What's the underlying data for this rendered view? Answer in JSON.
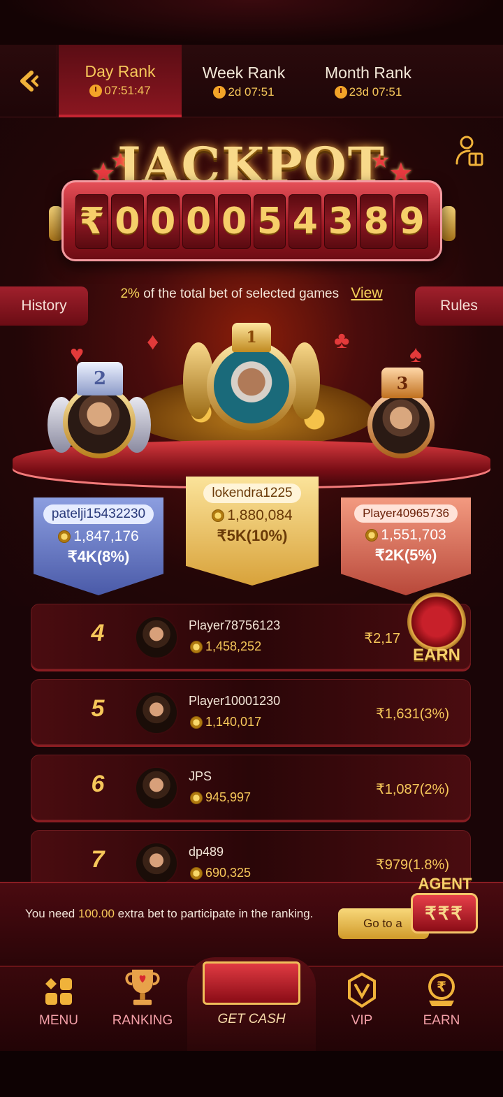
{
  "tabs": [
    {
      "label": "Day Rank",
      "time": "07:51:47"
    },
    {
      "label": "Week Rank",
      "time": "2d 07:51"
    },
    {
      "label": "Month Rank",
      "time": "23d 07:51"
    }
  ],
  "jackpot": {
    "title": "JACKPOT",
    "currency": "₹",
    "digits": [
      "0",
      "0",
      "0",
      "0",
      "5",
      "4",
      "3",
      "8",
      "9"
    ],
    "note_pct": "2%",
    "note_text": "of the total bet of selected games",
    "view_label": "View"
  },
  "side_buttons": {
    "history": "History",
    "rules": "Rules"
  },
  "podium": [
    {
      "rank": "2",
      "name": "patelji15432230",
      "coins": "1,847,176",
      "prize": "₹4K(8%)"
    },
    {
      "rank": "1",
      "name": "lokendra1225",
      "coins": "1,880,084",
      "prize": "₹5K(10%)"
    },
    {
      "rank": "3",
      "name": "Player40965736",
      "coins": "1,551,703",
      "prize": "₹2K(5%)"
    }
  ],
  "rows": [
    {
      "rank": "4",
      "name": "Player78756123",
      "coins": "1,458,252",
      "prize": "₹2,17"
    },
    {
      "rank": "5",
      "name": "Player10001230",
      "coins": "1,140,017",
      "prize": "₹1,631(3%)"
    },
    {
      "rank": "6",
      "name": "JPS",
      "coins": "945,997",
      "prize": "₹1,087(2%)"
    },
    {
      "rank": "7",
      "name": "dp489",
      "coins": "690,325",
      "prize": "₹979(1.8%)"
    }
  ],
  "earn_float": {
    "label": "EARN"
  },
  "notice": {
    "prefix": "You need ",
    "amount": "100.00",
    "suffix": " extra bet to participate in the ranking.",
    "button": "Go to a"
  },
  "agent": {
    "title": "AGENT",
    "reels": "₹₹₹"
  },
  "nav": {
    "menu": "MENU",
    "ranking": "RANKING",
    "get_cash": "GET CASH",
    "vip": "VIP",
    "earn": "EARN"
  },
  "colors": {
    "gold": "#f6c75a",
    "accent_red": "#c42532",
    "background": "#1a0507"
  }
}
